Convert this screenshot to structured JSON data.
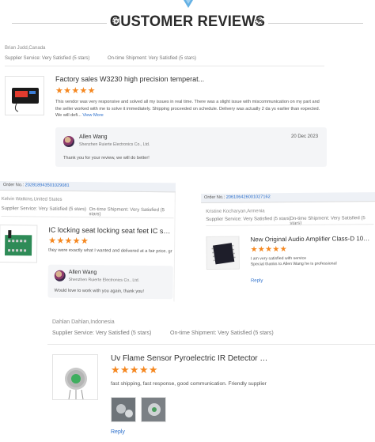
{
  "header": {
    "title": "CUSTOMER REVIEWS"
  },
  "reviews": [
    {
      "order": "",
      "buyer": "Brian Judd,Canada",
      "supplier_service": "Supplier Service:  Very Satisfied   (5 stars)",
      "ontime_shipment": "On-time Shipment:  Very Satisfied   (5 stars)",
      "product_title": "Factory sales W3230 high precision temperat...",
      "stars": "★★★★★",
      "body": "This vendor was very responsive and solved all my issues in real time. There was a slight issue with miscommunication on my part and the seller worked with me to solve it immediately. Shipping proceeded on schedule. Delivery was actually 2 da ys earlier than expected. We will defi...",
      "view_more": "View More",
      "reply": {
        "name": "Allen Wang",
        "company": "Shenzhen Ruierte Electronics Co., Ltd.",
        "date": "20 Dec 2023",
        "message": "Thank you for your review, we will do better!"
      }
    },
    {
      "order_label": "Order No.: ",
      "order_number": "202818943501029081",
      "buyer": "Kelvin Watkins,United States",
      "supplier_service": "Supplier Service:  Very Satisfied   (5 stars)",
      "ontime_shipment": "On-time Shipment:  Very Satisfied   (5 stars)",
      "product_title": "IC locking seat locking seat feet IC socket tes...",
      "stars": "★★★★★",
      "body": "they were exactly what I wanted and delivered at a fair price. gr",
      "reply": {
        "name": "Allen Wang",
        "company": "Shenzhen Ruierte Electronics Co., Ltd.",
        "message": "Would love to work with you again, thank you!"
      }
    },
    {
      "order_label": "Order No.: ",
      "order_number": "206106426001027162",
      "buyer": "Kristine Kocharyan,Armenia",
      "supplier_service": "Supplier Service:  Very Satisfied   (5 stars)",
      "ontime_shipment": "On-time Shipment:  Very Satisfied   (5 stars)",
      "product_title": "New Original Audio Amplifier Class-D 10V to ...",
      "stars": "★★★★★",
      "body_line1": "I am very satisfied with service",
      "body_line2": "Special thanks to Allen Wang he is professional",
      "reply_link": "Reply"
    },
    {
      "buyer": "Dahlan Dahlan,Indonesia",
      "supplier_service": "Supplier Service:  Very Satisfied   (5 stars)",
      "ontime_shipment": "On-time Shipment:  Very Satisfied   (5 stars)",
      "product_title": "Uv Flame Sensor Pyroelectric IR Detector Fla...",
      "stars": "★★★★★",
      "body": "fast shipping, fast response, good communication.  Friendly supplier",
      "reply_link": "Reply"
    }
  ],
  "colors": {
    "accent": "#2a6ecb",
    "stars": "#f5871f",
    "title": "#2b2b2b"
  },
  "icons": [
    "triangle-logo-icon",
    "gear-icon"
  ]
}
